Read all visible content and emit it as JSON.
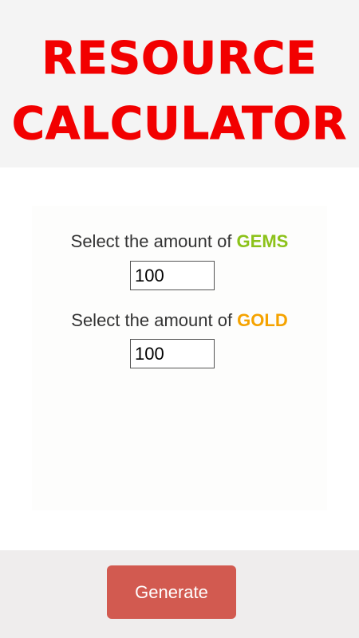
{
  "header": {
    "title_line1": "RESOURCE",
    "title_line2": "CALCULATOR"
  },
  "form": {
    "gems": {
      "prefix": "Select the amount of ",
      "resource": "GEMS",
      "value": "100"
    },
    "gold": {
      "prefix": "Select the amount of ",
      "resource": "GOLD",
      "value": "100"
    }
  },
  "footer": {
    "generate_label": "Generate"
  },
  "colors": {
    "title": "#f20000",
    "gems": "#8cc21a",
    "gold": "#f5a300",
    "button": "#d25a50"
  }
}
